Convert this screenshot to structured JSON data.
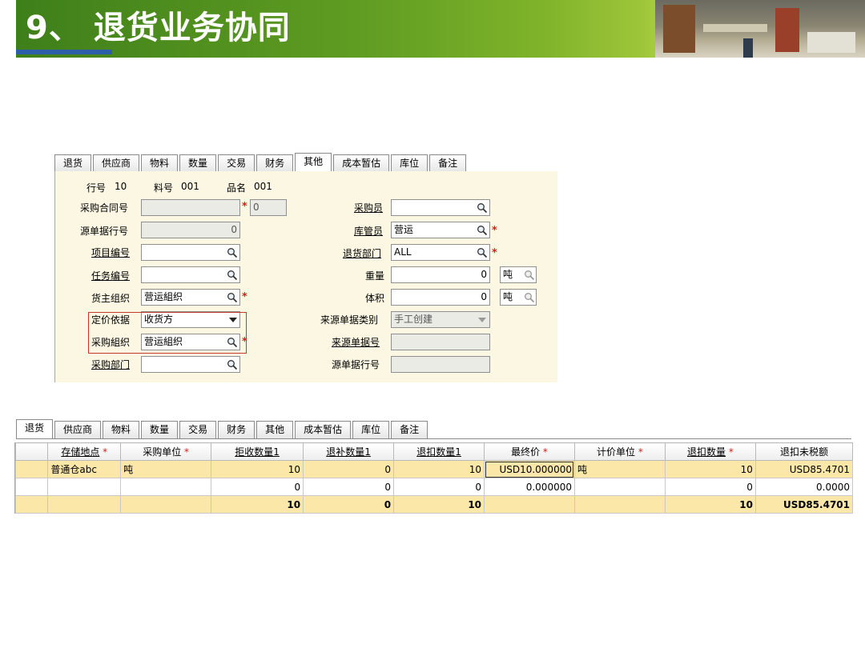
{
  "slide": {
    "title": "9、 退货业务协同"
  },
  "form": {
    "tabs": [
      {
        "label": "退货",
        "active": false
      },
      {
        "label": "供应商",
        "active": false
      },
      {
        "label": "物料",
        "active": false
      },
      {
        "label": "数量",
        "active": false
      },
      {
        "label": "交易",
        "active": false
      },
      {
        "label": "财务",
        "active": false
      },
      {
        "label": "其他",
        "active": true
      },
      {
        "label": "成本暂估",
        "active": false
      },
      {
        "label": "库位",
        "active": false
      },
      {
        "label": "备注",
        "active": false
      }
    ],
    "info": {
      "line_label": "行号",
      "line_value": "10",
      "item_label": "料号",
      "item_value": "001",
      "name_label": "品名",
      "name_value": "001"
    },
    "left": {
      "contract_label": "采购合同号",
      "contract_value": "",
      "contract_extra": "0",
      "src_line_label": "源单据行号",
      "src_line_value": "0",
      "project_label": "项目编号",
      "project_value": "",
      "task_label": "任务编号",
      "task_value": "",
      "owner_org_label": "货主组织",
      "owner_org_value": "营运組织",
      "pricing_label": "定价依据",
      "pricing_value": "收货方",
      "purch_org_label": "采购組织",
      "purch_org_value": "营运組织",
      "purch_dept_label": "采购部门",
      "purch_dept_value": ""
    },
    "right": {
      "buyer_label": "采购员",
      "buyer_value": "",
      "keeper_label": "库管员",
      "keeper_value": "营运",
      "return_dept_label": "退货部门",
      "return_dept_value": "ALL",
      "weight_label": "重量",
      "weight_value": "0",
      "weight_unit": "吨",
      "volume_label": "体积",
      "volume_value": "0",
      "volume_unit": "吨",
      "src_type_label": "来源单据类别",
      "src_type_value": "手工创建",
      "src_no_label": "来源单据号",
      "src_no_value": "",
      "src_line2_label": "源单据行号",
      "src_line2_value": ""
    }
  },
  "grid": {
    "tabs": [
      {
        "label": "退货",
        "active": true
      },
      {
        "label": "供应商",
        "active": false
      },
      {
        "label": "物料",
        "active": false
      },
      {
        "label": "数量",
        "active": false
      },
      {
        "label": "交易",
        "active": false
      },
      {
        "label": "财务",
        "active": false
      },
      {
        "label": "其他",
        "active": false
      },
      {
        "label": "成本暂估",
        "active": false
      },
      {
        "label": "库位",
        "active": false
      },
      {
        "label": "备注",
        "active": false
      }
    ],
    "columns": [
      {
        "label": "存储地点",
        "required": true,
        "link": true
      },
      {
        "label": "采购单位",
        "required": true,
        "link": false
      },
      {
        "label": "拒收数量1",
        "required": false,
        "link": true
      },
      {
        "label": "退补数量1",
        "required": false,
        "link": true
      },
      {
        "label": "退扣数量1",
        "required": false,
        "link": true
      },
      {
        "label": "最终价",
        "required": true,
        "link": false
      },
      {
        "label": "计价单位",
        "required": true,
        "link": false
      },
      {
        "label": "退扣数量",
        "required": true,
        "link": true
      },
      {
        "label": "退扣未税额",
        "required": false,
        "link": false
      }
    ],
    "rows": [
      {
        "kind": "sel",
        "cells": [
          "普通仓abc",
          "吨",
          "10",
          "0",
          "10",
          "USD10.000000",
          "吨",
          "10",
          "USD85.4701"
        ]
      },
      {
        "kind": "plain",
        "cells": [
          "",
          "",
          "0",
          "0",
          "0",
          "0.000000",
          "",
          "0",
          "0.0000"
        ]
      },
      {
        "kind": "total",
        "cells": [
          "",
          "",
          "10",
          "0",
          "10",
          "",
          "",
          "10",
          "USD85.4701"
        ]
      }
    ]
  },
  "colors": {
    "banner_green": "#5f9c22",
    "panel_bg": "#fbf7e3",
    "row_highlight": "#fbe7a8",
    "required_star": "#d21e1e",
    "highlight_box": "#c43b2b"
  },
  "icons": {
    "lookup": "magnifier-icon",
    "dropdown": "chevron-down-icon"
  }
}
